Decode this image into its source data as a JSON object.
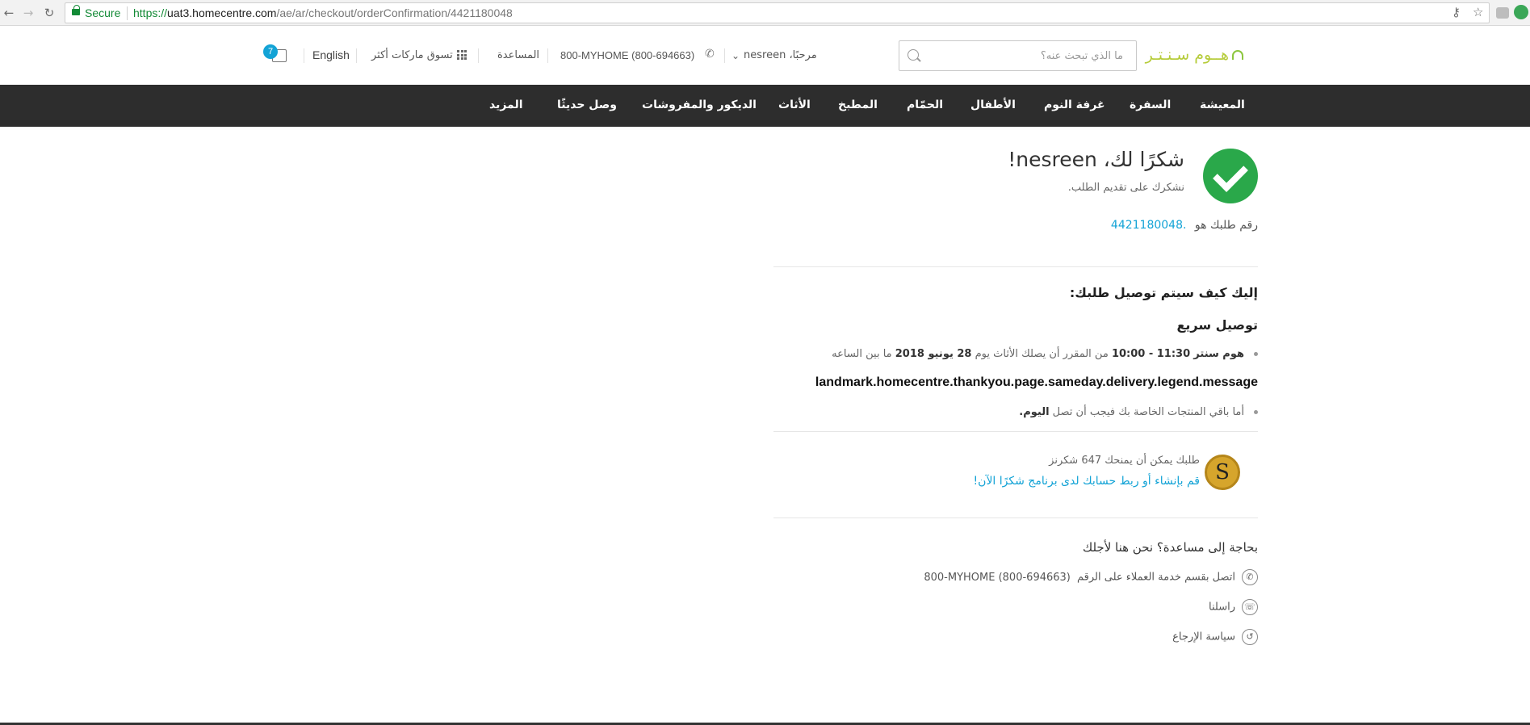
{
  "browser": {
    "secure_label": "Secure",
    "url_scheme": "https://",
    "url_host": "uat3.homecentre.com",
    "url_path": "/ae/ar/checkout/orderConfirmation/4421180048"
  },
  "header": {
    "logo_text": "هــوم سـنـتـر",
    "search_placeholder": "ما الذي تبحث عنه؟",
    "greeting": "مرحبًا، nesreen",
    "phone": "800-MYHOME (800-694663)",
    "help": "المساعدة",
    "shop_brands": "تسوق ماركات أكثر",
    "language": "English",
    "bag_count": "7"
  },
  "nav": {
    "items": [
      "المعيشة",
      "السفرة",
      "غرفة النوم",
      "الأطفال",
      "الحمّام",
      "المطبخ",
      "الأثاث",
      "الديكور والمفروشات",
      "وصل حديثًا",
      "المزيد"
    ]
  },
  "confirmation": {
    "title": "شكرًا لك، nesreen!",
    "subtitle": "نشكرك على تقديم الطلب.",
    "order_label": "رقم طلبك هو",
    "order_number": "4421180048.",
    "delivery_heading": "إليك كيف سيتم توصيل طلبك:",
    "express_heading": "توصيل سريع",
    "delivery_brand": "هوم سنتر",
    "delivery_time": "10:00 - 11:30",
    "delivery_text_mid": "من المقرر أن يصلك الأثاث يوم",
    "delivery_date": "28 يونيو 2018",
    "delivery_text_end": "ما بين الساعه",
    "legend_message": "landmark.homecentre.thankyou.page.sameday.delivery.legend.message",
    "rest_text": "أما باقي المنتجات الخاصة بك فيجب أن تصل",
    "rest_today": "اليوم."
  },
  "shukran": {
    "coin_letter": "S",
    "points_text": "طلبك يمكن أن يمنحك 647 شكرنز",
    "link_text": "قم بإنشاء أو ربط حسابك لدى برنامج شكرًا الآن!"
  },
  "help": {
    "title": "بحاجة إلى مساعدة؟ نحن هنا لأجلك",
    "call_text": "اتصل بقسم خدمة العملاء على الرقم",
    "call_number": "800-MYHOME (800-694663)",
    "contact_text": "راسلنا",
    "returns_text": "سياسة الإرجاع"
  },
  "colors": {
    "accent": "#13a3d6",
    "success": "#2aa84a",
    "brand": "#b6cc3b",
    "nav_bg": "#2d2d2d"
  }
}
